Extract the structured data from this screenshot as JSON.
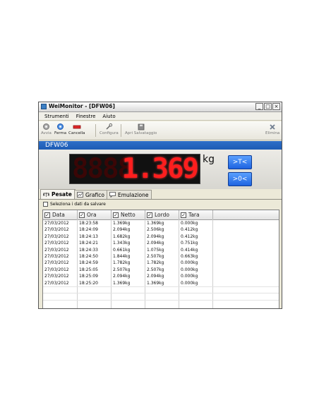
{
  "window": {
    "title": "WeiMonitor - [DFW06]",
    "controls": [
      "_",
      "□",
      "×"
    ]
  },
  "menu": [
    "Strumenti",
    "Finestre",
    "Aiuto"
  ],
  "toolbar": {
    "avvia": "Avvia",
    "ferma": "Ferma",
    "cancella": "Cancella",
    "configura": "Configura",
    "apri": "Apri Salvataggio",
    "elimina": "Elimina"
  },
  "device": {
    "name": "DFW06"
  },
  "display": {
    "ghost": "8888",
    "value": "1.369",
    "unit": "kg",
    "tare_button": ">T<",
    "zero_button": ">0<"
  },
  "tabs": [
    "Pesate",
    "Grafico",
    "Emulazione"
  ],
  "save_checkbox_label": "Seleziona i dati da salvare",
  "table": {
    "columns": [
      "Data",
      "Ora",
      "Netto",
      "Lordo",
      "Tara"
    ],
    "rows": [
      [
        "27/03/2012",
        "18:23:58",
        "1.369kg",
        "1.369kg",
        "0.000kg"
      ],
      [
        "27/03/2012",
        "18:24:09",
        "2.094kg",
        "2.506kg",
        "0.412kg"
      ],
      [
        "27/03/2012",
        "18:24:13",
        "1.682kg",
        "2.094kg",
        "0.412kg"
      ],
      [
        "27/03/2012",
        "18:24:21",
        "1.343kg",
        "2.094kg",
        "0.751kg"
      ],
      [
        "27/03/2012",
        "18:24:33",
        "0.661kg",
        "1.075kg",
        "0.414kg"
      ],
      [
        "27/03/2012",
        "18:24:50",
        "1.844kg",
        "2.507kg",
        "0.663kg"
      ],
      [
        "27/03/2012",
        "18:24:59",
        "1.782kg",
        "1.782kg",
        "0.000kg"
      ],
      [
        "27/03/2012",
        "18:25:05",
        "2.507kg",
        "2.507kg",
        "0.000kg"
      ],
      [
        "27/03/2012",
        "18:25:09",
        "2.094kg",
        "2.094kg",
        "0.000kg"
      ],
      [
        "27/03/2012",
        "18:25:20",
        "1.369kg",
        "1.369kg",
        "0.000kg"
      ]
    ]
  },
  "colors": {
    "display_digit": "#ff1e1e",
    "device_band": "#1d5bb4",
    "control_button": "#1e63e0"
  }
}
